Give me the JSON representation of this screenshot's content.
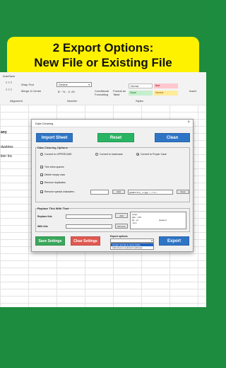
{
  "banner": {
    "line1": "2 Export Options:",
    "line2": "New File or Existing File"
  },
  "ribbon": {
    "autosave": "AutoSave",
    "wrap_text": "Wrap Text",
    "merge_center": "Merge & Centre",
    "number_format": "General",
    "group_alignment": "Alignment",
    "group_number": "Number",
    "group_styles": "Styles",
    "conditional_formatting": "Conditional Formatting",
    "format_as_table": "Format as Table",
    "style_normal": "Normal",
    "style_bad": "Bad",
    "style_good": "Good",
    "style_neutral": "Neutral",
    "insert": "Insert"
  },
  "sheet": {
    "cell1": "any",
    "cell2": "dustries",
    "cell3": "tion Inc"
  },
  "dialog": {
    "title": "Data Cleaning",
    "close": "×",
    "import_sheet": "Import Sheet",
    "reset": "Reset",
    "clean": "Clean",
    "options_title": "Data Cleaning Options",
    "case_upper": "Convert to UPPERCASE",
    "case_lower": "Convert to lowercase",
    "case_proper": "Convert to Proper Case",
    "trim": "Trim extra spaces",
    "delete_empty": "Delete empty rows",
    "remove_dupes": "Remove duplicates",
    "remove_special": "Remove special characters",
    "special_chars": "@#$%^&*()-_=+[]{}|;:'\",.<>?/`~",
    "add": "Add",
    "clear": "Clear",
    "replace_title": "Replace This With That",
    "replace_this": "Replace this",
    "with_this": "With this",
    "add_pair": "Add",
    "remove_pair": "Remove",
    "pairs": [
      "script",
      "abe→123",
      "@→at",
      ".com"
    ],
    "pair_values": [
      "",
      "",
      "cleaned",
      ""
    ],
    "save_settings": "Save Settings",
    "clear_settings": "Clear Settings",
    "export_options": "Export options",
    "export_value": "",
    "export_dropdown": [
      "Create new file in same folder",
      "Add sheet to selected workbook"
    ],
    "export": "Export"
  },
  "colors": {
    "import_blue": "#2e75c6",
    "reset_green": "#28b463",
    "clean_blue": "#2e75c6",
    "save_green": "#3aa85c",
    "clear_red": "#e05a52",
    "export_blue": "#2e75c6",
    "banner_yellow": "#fff200",
    "background_green": "#1d8c3e"
  }
}
